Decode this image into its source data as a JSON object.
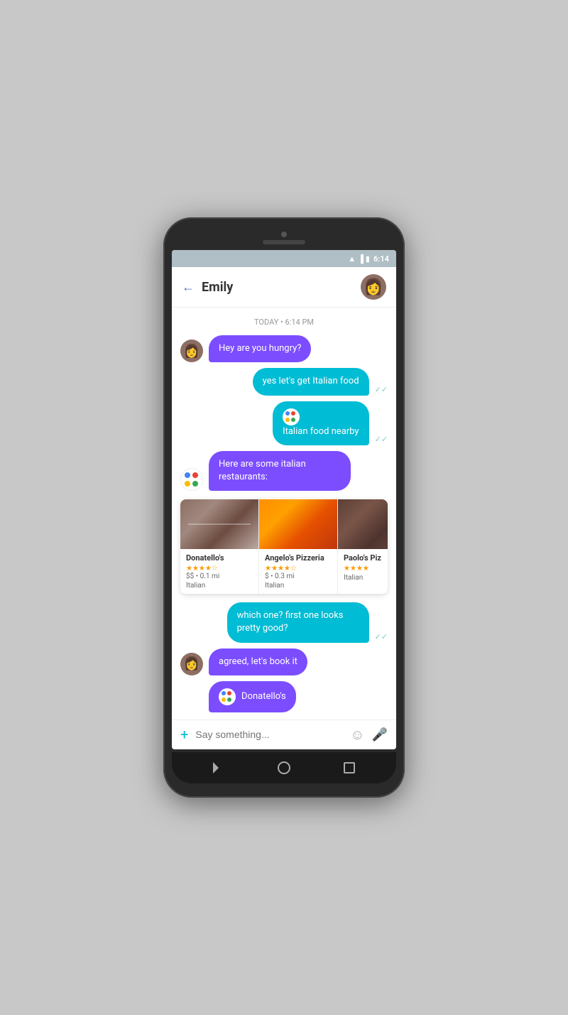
{
  "status_bar": {
    "time": "6:14"
  },
  "header": {
    "back_label": "←",
    "name": "Emily"
  },
  "chat": {
    "date_separator": "TODAY • 6:14 PM",
    "messages": [
      {
        "id": "msg1",
        "type": "received",
        "text": "Hey are you hungry?",
        "has_avatar": true
      },
      {
        "id": "msg2",
        "type": "sent",
        "text": "yes let's get Italian food",
        "has_check": true
      },
      {
        "id": "msg3",
        "type": "sent-assistant",
        "text": "Italian food nearby",
        "has_check": true
      },
      {
        "id": "msg4",
        "type": "assistant",
        "text": "Here are some italian restaurants:",
        "has_avatar": true
      }
    ],
    "restaurants": [
      {
        "name": "Donatello's",
        "stars": "★★★★☆",
        "price": "$$",
        "distance": "0.1 mi",
        "cuisine": "Italian"
      },
      {
        "name": "Angelo's Pizzeria",
        "stars": "★★★★☆",
        "price": "$",
        "distance": "0.3 mi",
        "cuisine": "Italian"
      },
      {
        "name": "Paolo's Piz",
        "stars": "★★★★",
        "price": "",
        "distance": "",
        "cuisine": "Italian"
      }
    ],
    "later_messages": [
      {
        "id": "msg5",
        "type": "sent",
        "text": "which one? first one looks pretty good?",
        "has_check": true
      },
      {
        "id": "msg6",
        "type": "received",
        "text": "agreed, let's book it",
        "has_avatar": true
      },
      {
        "id": "msg7",
        "type": "assistant-received",
        "text": "Donatello's",
        "has_avatar": false
      }
    ]
  },
  "input_bar": {
    "placeholder": "Say something...",
    "plus_label": "+",
    "emoji_label": "☺",
    "mic_label": "🎤"
  },
  "nav": {
    "back": "◁",
    "home": "○",
    "recent": "□"
  }
}
